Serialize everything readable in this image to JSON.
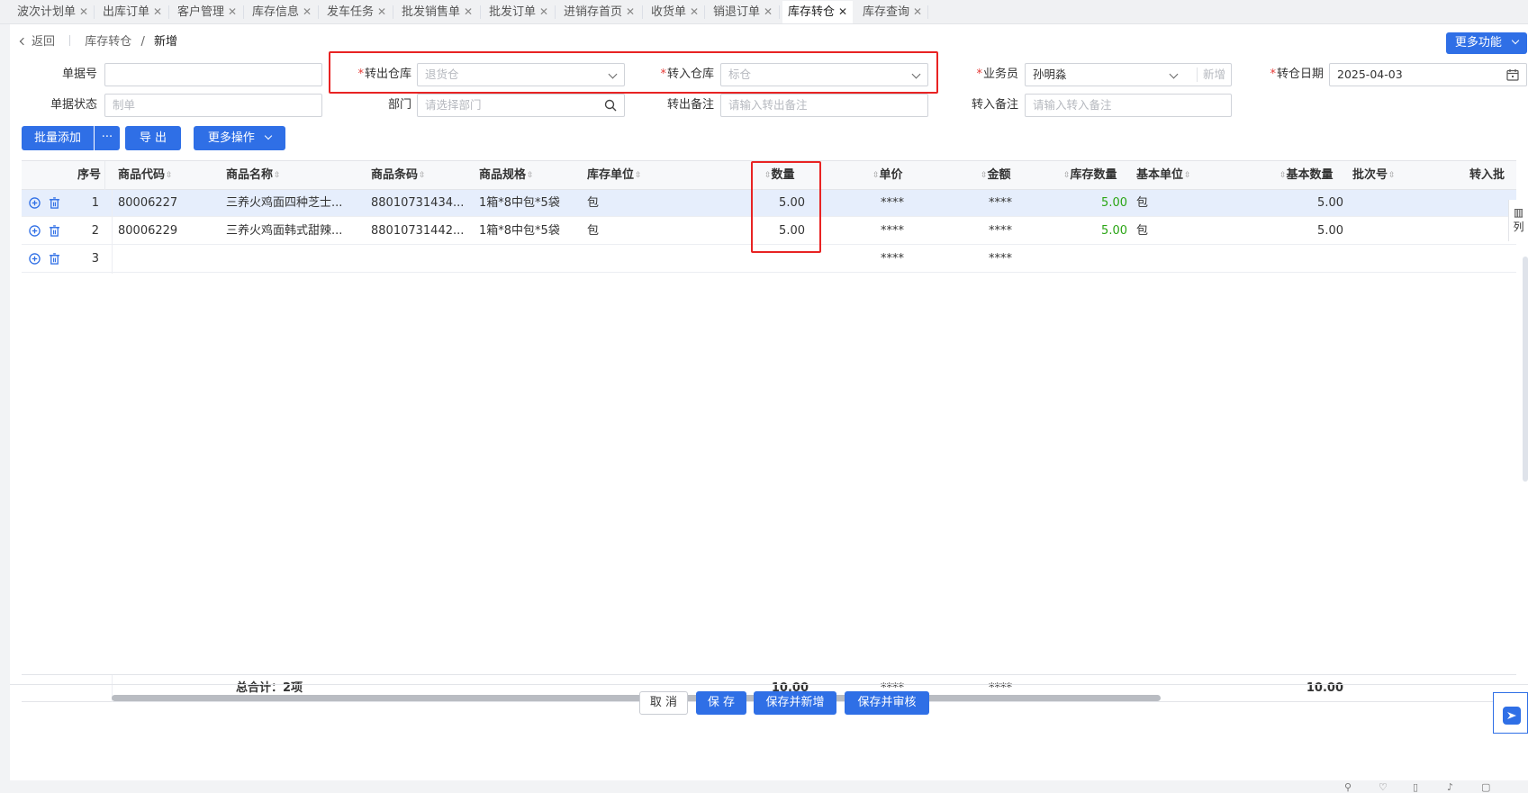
{
  "tabs": [
    {
      "label": "波次计划单",
      "active": false
    },
    {
      "label": "出库订单",
      "active": false
    },
    {
      "label": "客户管理",
      "active": false
    },
    {
      "label": "库存信息",
      "active": false
    },
    {
      "label": "发车任务",
      "active": false
    },
    {
      "label": "批发销售单",
      "active": false
    },
    {
      "label": "批发订单",
      "active": false
    },
    {
      "label": "进销存首页",
      "active": false
    },
    {
      "label": "收货单",
      "active": false
    },
    {
      "label": "销退订单",
      "active": false
    },
    {
      "label": "库存转仓",
      "active": true
    },
    {
      "label": "库存查询",
      "active": false
    }
  ],
  "header": {
    "back_label": "返回",
    "breadcrumb_parent": "库存转仓",
    "breadcrumb_sep": "/",
    "breadcrumb_current": "新增",
    "more_functions_label": "更多功能"
  },
  "form": {
    "doc_no": {
      "label": "单据号",
      "value": ""
    },
    "out_warehouse": {
      "label": "转出仓库",
      "required": true,
      "value": "退货仓"
    },
    "in_warehouse": {
      "label": "转入仓库",
      "required": true,
      "value": "标仓"
    },
    "salesman": {
      "label": "业务员",
      "required": true,
      "value": "孙明淼",
      "new_label": "新增"
    },
    "transfer_date": {
      "label": "转仓日期",
      "required": true,
      "value": "2025-04-03"
    },
    "doc_status": {
      "label": "单据状态",
      "value": "制单"
    },
    "department": {
      "label": "部门",
      "placeholder": "请选择部门"
    },
    "out_remark": {
      "label": "转出备注",
      "placeholder": "请输入转出备注"
    },
    "in_remark": {
      "label": "转入备注",
      "placeholder": "请输入转入备注"
    }
  },
  "toolbar": {
    "batch_add_label": "批量添加",
    "batch_more_label": "···",
    "export_label": "导 出",
    "more_ops_label": "更多操作"
  },
  "table": {
    "columns": [
      "序号",
      "商品代码",
      "商品名称",
      "商品条码",
      "商品规格",
      "库存单位",
      "数量",
      "单价",
      "金额",
      "库存数量",
      "基本单位",
      "基本数量",
      "批次号",
      "转入批"
    ],
    "rows": [
      {
        "seq": "1",
        "code": "80006227",
        "name": "三养火鸡面四种芝士...",
        "barcode": "88010731434...",
        "spec": "1箱*8中包*5袋",
        "unit": "包",
        "qty": "5.00",
        "price": "****",
        "amount": "****",
        "stock_qty": "5.00",
        "base_unit": "包",
        "base_qty": "5.00"
      },
      {
        "seq": "2",
        "code": "80006229",
        "name": "三养火鸡面韩式甜辣...",
        "barcode": "88010731442...",
        "spec": "1箱*8中包*5袋",
        "unit": "包",
        "qty": "5.00",
        "price": "****",
        "amount": "****",
        "stock_qty": "5.00",
        "base_unit": "包",
        "base_qty": "5.00"
      },
      {
        "seq": "3",
        "price": "****",
        "amount": "****"
      }
    ],
    "total_label": "总合计：2项",
    "total_qty": "10.00",
    "total_price": "****",
    "total_amount": "****",
    "total_base_qty": "10.00",
    "column_settings_label": "列"
  },
  "footer": {
    "cancel_label": "取 消",
    "save_label": "保 存",
    "save_new_label": "保存并新增",
    "save_audit_label": "保存并审核"
  },
  "colors": {
    "primary": "#2f6fe6",
    "highlight": "#e82323",
    "stock_green": "#2aa515",
    "selected_row": "#e6eefc"
  }
}
